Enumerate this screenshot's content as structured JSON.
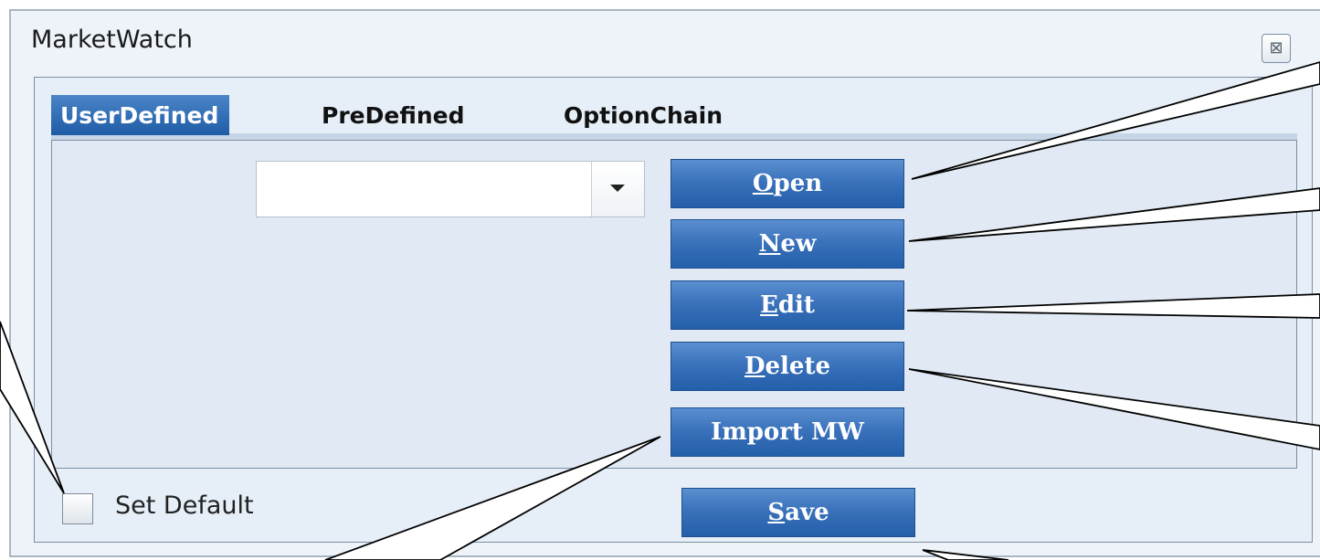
{
  "window": {
    "title": "MarketWatch",
    "close_glyph": "⊠"
  },
  "tabs": [
    {
      "label": "UserDefined",
      "active": true
    },
    {
      "label": "PreDefined",
      "active": false
    },
    {
      "label": "OptionChain",
      "active": false
    }
  ],
  "combo": {
    "value": "",
    "placeholder": ""
  },
  "buttons": {
    "open": {
      "mnemonic": "O",
      "rest": "pen"
    },
    "new": {
      "mnemonic": "N",
      "rest": "ew"
    },
    "edit": {
      "mnemonic": "E",
      "rest": "dit"
    },
    "delete": {
      "mnemonic": "D",
      "rest": "elete"
    },
    "import": {
      "label": "Import MW"
    },
    "save": {
      "mnemonic": "S",
      "rest": "ave"
    }
  },
  "set_default": {
    "label": "Set Default",
    "checked": false
  },
  "colors": {
    "button_blue": "#2f69b3",
    "active_tab": "#2f6bb5",
    "panel_bg": "#e1eaf4"
  }
}
